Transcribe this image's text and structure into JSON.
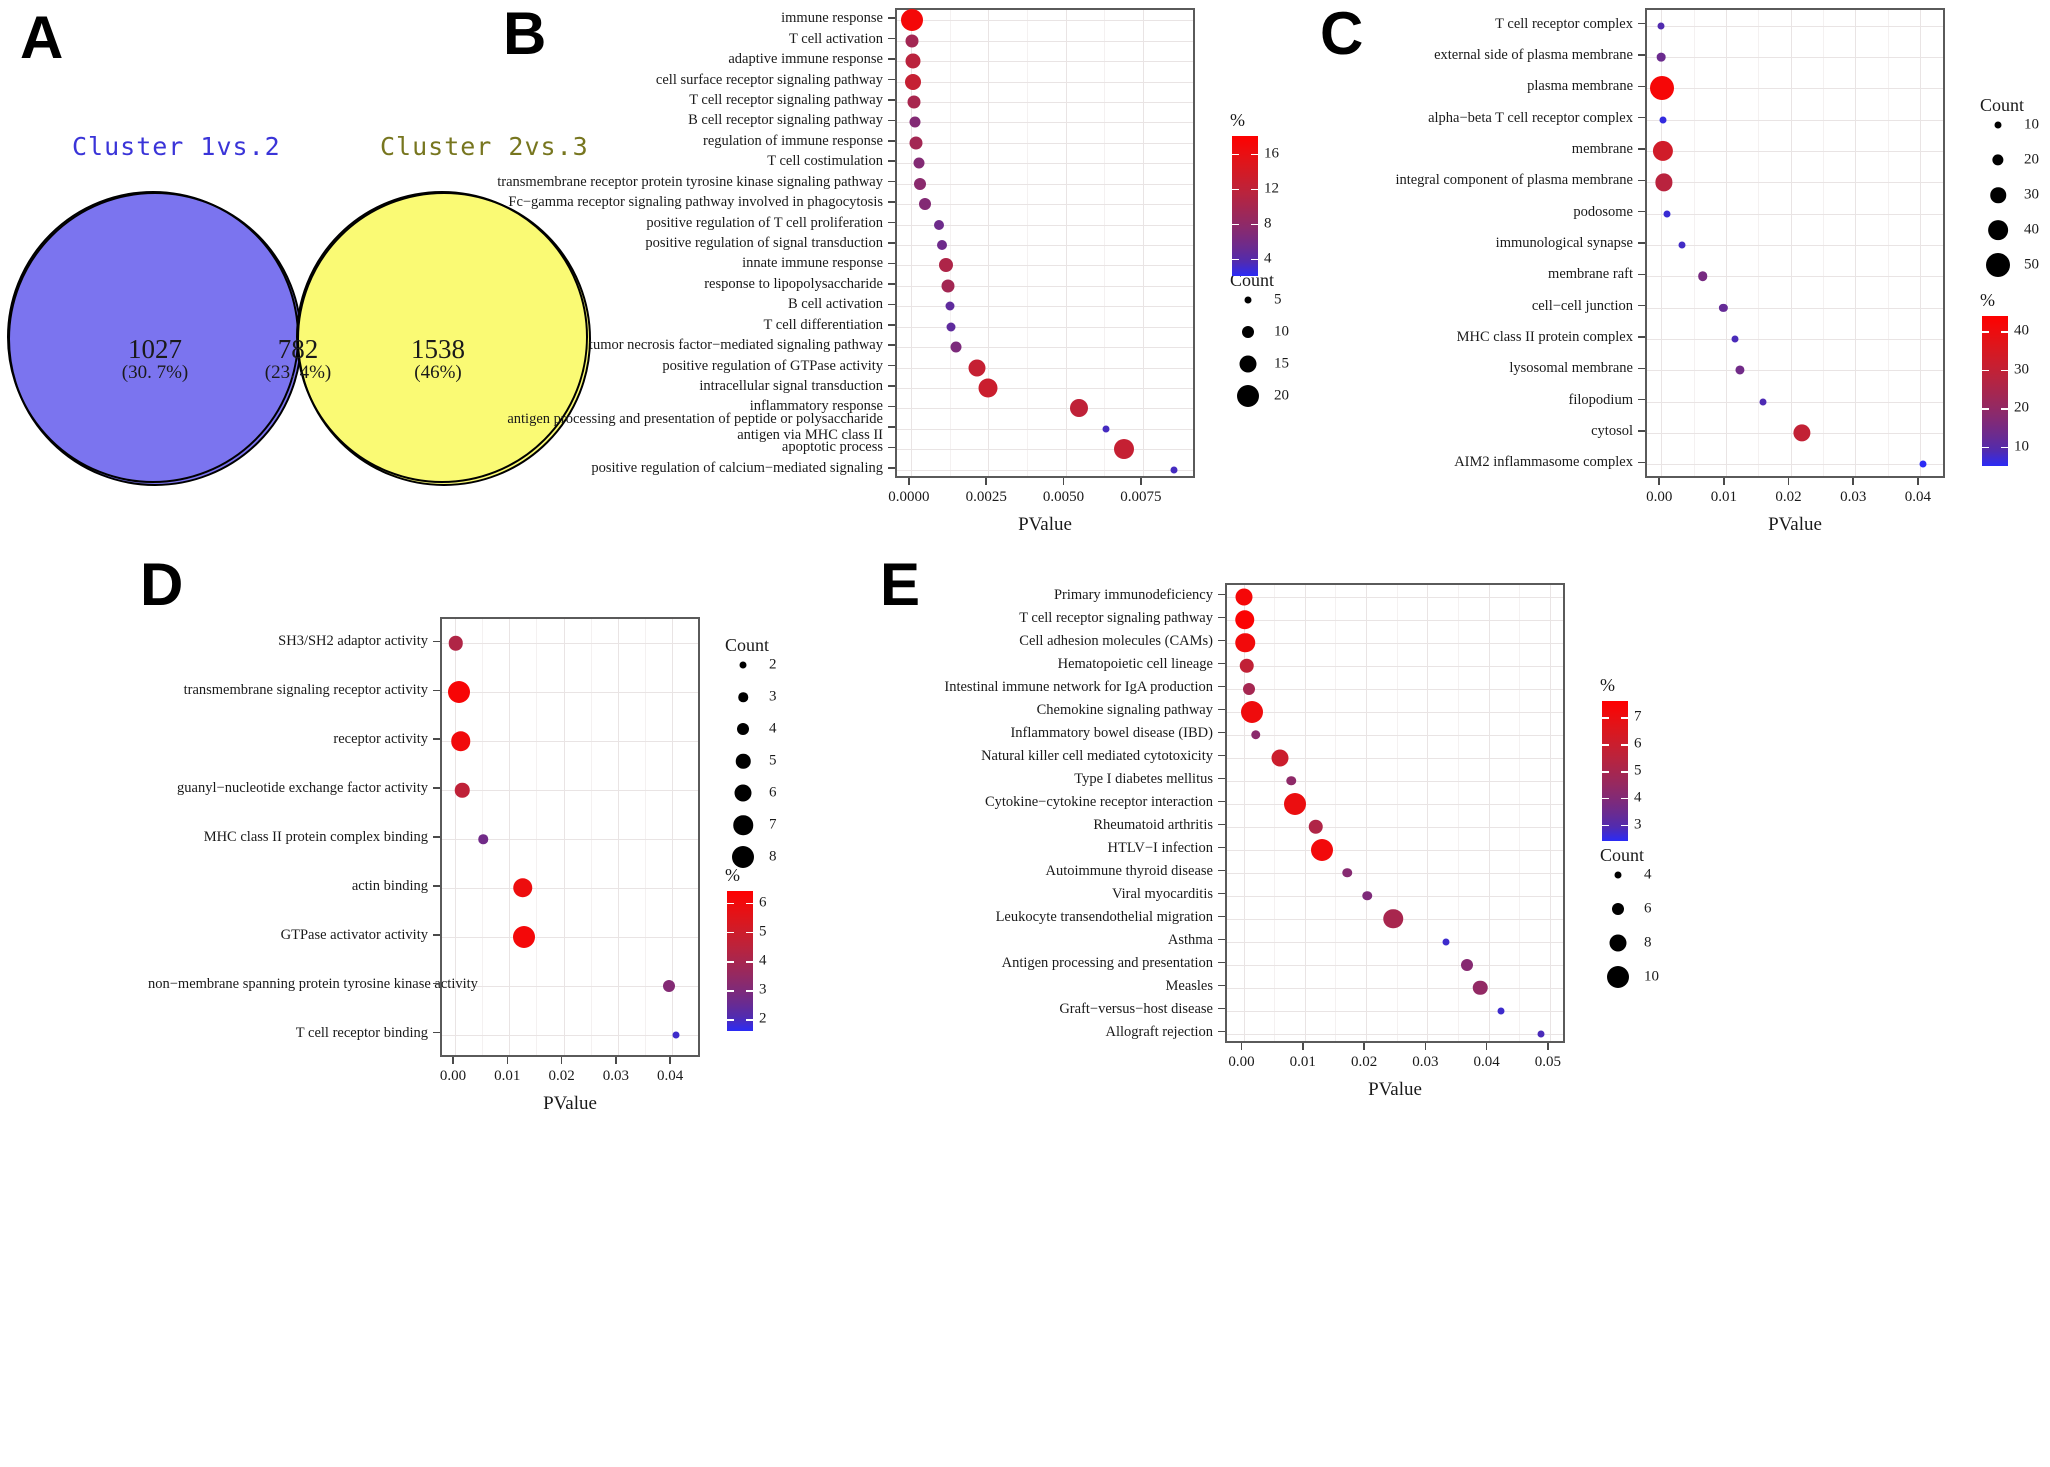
{
  "figure": {
    "panels": [
      "A",
      "B",
      "C",
      "D",
      "E"
    ]
  },
  "panelA": {
    "letter": "A",
    "left_title": "Cluster 1vs.2",
    "right_title": "Cluster 2vs.3",
    "left_color": "#7b74ef",
    "right_color": "#fafa74",
    "overlap_color": "#9d975f",
    "left_title_color": "#3a34d8",
    "right_title_color": "#77761f",
    "regions": [
      {
        "name": "left-only",
        "count": "1027",
        "percent": "(30. 7%)"
      },
      {
        "name": "intersection",
        "count": "782",
        "percent": "(23. 4%)"
      },
      {
        "name": "right-only",
        "count": "1538",
        "percent": "(46%)"
      }
    ]
  },
  "chart_data": [
    {
      "panel": "B",
      "letter": "B",
      "type": "scatter",
      "title": "",
      "xlabel": "PValue",
      "ylabel": "",
      "xlim": [
        -0.00045,
        0.00925
      ],
      "xticks": [
        0.0,
        0.0025,
        0.005,
        0.0075
      ],
      "xticklabels": [
        "0.0000",
        "0.0025",
        "0.0050",
        "0.0075"
      ],
      "grid": true,
      "legend_position": "right",
      "size_legend": {
        "title": "Count",
        "values": [
          5,
          10,
          15,
          20
        ]
      },
      "color_legend": {
        "title": "%",
        "ticks": [
          16,
          12,
          8,
          4
        ],
        "vmin": 2,
        "vmax": 18,
        "low_color": "#2b2bf5",
        "high_color": "#fe0000"
      },
      "categories": [
        "immune response",
        "T cell activation",
        "adaptive immune response",
        "cell surface receptor signaling pathway",
        "T cell receptor signaling pathway",
        "B cell receptor signaling pathway",
        "regulation of immune response",
        "T cell costimulation",
        "transmembrane receptor protein tyrosine kinase signaling pathway",
        "Fc−gamma receptor signaling pathway involved in phagocytosis",
        "positive regulation of T cell proliferation",
        "positive regulation of signal transduction",
        "innate immune response",
        "response to lipopolysaccharide",
        "B cell activation",
        "T cell differentiation",
        "tumor necrosis factor−mediated signaling pathway",
        "positive regulation of GTPase activity",
        "intracellular signal transduction",
        "inflammatory response",
        "antigen processing and presentation of peptide or polysaccharide antigen via MHC class II",
        "apoptotic process",
        "positive regulation of calcium−mediated signaling"
      ],
      "points": [
        {
          "pvalue": 2e-05,
          "count": 21,
          "percent": 17.0
        },
        {
          "pvalue": 4e-05,
          "count": 11,
          "percent": 9.5
        },
        {
          "pvalue": 6e-05,
          "count": 13,
          "percent": 11.5
        },
        {
          "pvalue": 8e-05,
          "count": 14,
          "percent": 12.5
        },
        {
          "pvalue": 0.0001,
          "count": 11,
          "percent": 10.0
        },
        {
          "pvalue": 0.00012,
          "count": 9,
          "percent": 7.0
        },
        {
          "pvalue": 0.00016,
          "count": 11,
          "percent": 9.5
        },
        {
          "pvalue": 0.00025,
          "count": 9,
          "percent": 7.0
        },
        {
          "pvalue": 0.0003,
          "count": 10,
          "percent": 7.5
        },
        {
          "pvalue": 0.00045,
          "count": 10,
          "percent": 7.0
        },
        {
          "pvalue": 0.0009,
          "count": 8,
          "percent": 5.5
        },
        {
          "pvalue": 0.001,
          "count": 8,
          "percent": 5.5
        },
        {
          "pvalue": 0.00115,
          "count": 12,
          "percent": 10.5
        },
        {
          "pvalue": 0.0012,
          "count": 11,
          "percent": 9.5
        },
        {
          "pvalue": 0.00125,
          "count": 7,
          "percent": 4.5
        },
        {
          "pvalue": 0.0013,
          "count": 7,
          "percent": 4.5
        },
        {
          "pvalue": 0.00145,
          "count": 9,
          "percent": 6.5
        },
        {
          "pvalue": 0.00215,
          "count": 15,
          "percent": 12.5
        },
        {
          "pvalue": 0.0025,
          "count": 17,
          "percent": 13.0
        },
        {
          "pvalue": 0.00545,
          "count": 16,
          "percent": 12.0
        },
        {
          "pvalue": 0.0063,
          "count": 4,
          "percent": 3.0
        },
        {
          "pvalue": 0.0069,
          "count": 18,
          "percent": 12.5
        },
        {
          "pvalue": 0.0085,
          "count": 4,
          "percent": 3.0
        }
      ]
    },
    {
      "panel": "C",
      "letter": "C",
      "type": "scatter",
      "xlabel": "PValue",
      "xlim": [
        -0.0022,
        0.0442
      ],
      "xticks": [
        0.0,
        0.01,
        0.02,
        0.03,
        0.04
      ],
      "xticklabels": [
        "0.00",
        "0.01",
        "0.02",
        "0.03",
        "0.04"
      ],
      "grid": true,
      "legend_position": "right",
      "size_legend": {
        "title": "Count",
        "values": [
          10,
          20,
          30,
          40,
          50
        ]
      },
      "color_legend": {
        "title": "%",
        "ticks": [
          40,
          30,
          20,
          10
        ],
        "vmin": 5,
        "vmax": 44,
        "low_color": "#2b2bf5",
        "high_color": "#fe0000"
      },
      "categories": [
        "T cell receptor complex",
        "external side of plasma membrane",
        "plasma membrane",
        "alpha−beta T cell receptor complex",
        "membrane",
        "integral component of plasma membrane",
        "podosome",
        "immunological synapse",
        "membrane raft",
        "cell−cell junction",
        "MHC class II protein complex",
        "lysosomal membrane",
        "filopodium",
        "cytosol",
        "AIM2 inflammasome complex"
      ],
      "points": [
        {
          "pvalue": 2e-05,
          "count": 9,
          "percent": 9.0
        },
        {
          "pvalue": 4e-05,
          "count": 14,
          "percent": 13.0
        },
        {
          "pvalue": 6e-05,
          "count": 52,
          "percent": 42.0
        },
        {
          "pvalue": 0.0002,
          "count": 6,
          "percent": 5.5
        },
        {
          "pvalue": 0.0003,
          "count": 41,
          "percent": 33.0
        },
        {
          "pvalue": 0.0004,
          "count": 34,
          "percent": 28.0
        },
        {
          "pvalue": 0.0009,
          "count": 7,
          "percent": 6.0
        },
        {
          "pvalue": 0.0032,
          "count": 8,
          "percent": 7.0
        },
        {
          "pvalue": 0.0064,
          "count": 16,
          "percent": 15.0
        },
        {
          "pvalue": 0.0096,
          "count": 13,
          "percent": 12.0
        },
        {
          "pvalue": 0.0114,
          "count": 9,
          "percent": 8.0
        },
        {
          "pvalue": 0.0122,
          "count": 15,
          "percent": 14.0
        },
        {
          "pvalue": 0.0158,
          "count": 9,
          "percent": 8.5
        },
        {
          "pvalue": 0.0218,
          "count": 34,
          "percent": 30.0
        },
        {
          "pvalue": 0.0405,
          "count": 5,
          "percent": 4.5
        }
      ]
    },
    {
      "panel": "D",
      "letter": "D",
      "type": "scatter",
      "xlabel": "PValue",
      "xlim": [
        -0.0024,
        0.0455
      ],
      "xticks": [
        0.0,
        0.01,
        0.02,
        0.03,
        0.04
      ],
      "xticklabels": [
        "0.00",
        "0.01",
        "0.02",
        "0.03",
        "0.04"
      ],
      "grid": true,
      "legend_position": "right",
      "size_legend": {
        "title": "Count",
        "values": [
          2,
          3,
          4,
          5,
          6,
          7,
          8
        ]
      },
      "color_legend": {
        "title": "%",
        "ticks": [
          6,
          5,
          4,
          3,
          2
        ],
        "vmin": 1.6,
        "vmax": 6.4,
        "low_color": "#2b2bf5",
        "high_color": "#fe0000"
      },
      "categories": [
        "SH3/SH2 adaptor activity",
        "transmembrane signaling receptor activity",
        "receptor activity",
        "guanyl−nucleotide exchange factor activity",
        "MHC class II protein complex binding",
        "actin binding",
        "GTPase activator activity",
        "non−membrane spanning protein tyrosine kinase activity",
        "T cell receptor binding"
      ],
      "points": [
        {
          "pvalue": 0.0001,
          "count": 5,
          "percent": 4.2
        },
        {
          "pvalue": 0.0008,
          "count": 8,
          "percent": 6.2
        },
        {
          "pvalue": 0.0011,
          "count": 7,
          "percent": 6.0
        },
        {
          "pvalue": 0.0013,
          "count": 5,
          "percent": 4.6
        },
        {
          "pvalue": 0.0052,
          "count": 3,
          "percent": 2.7
        },
        {
          "pvalue": 0.0125,
          "count": 7,
          "percent": 5.9
        },
        {
          "pvalue": 0.0127,
          "count": 8,
          "percent": 6.1
        },
        {
          "pvalue": 0.0395,
          "count": 4,
          "percent": 3.1
        },
        {
          "pvalue": 0.0408,
          "count": 2,
          "percent": 1.8
        }
      ]
    },
    {
      "panel": "E",
      "letter": "E",
      "type": "scatter",
      "xlabel": "PValue",
      "xlim": [
        -0.0027,
        0.0528
      ],
      "xticks": [
        0.0,
        0.01,
        0.02,
        0.03,
        0.04,
        0.05
      ],
      "xticklabels": [
        "0.00",
        "0.01",
        "0.02",
        "0.03",
        "0.04",
        "0.05"
      ],
      "grid": true,
      "legend_position": "right",
      "size_legend": {
        "title": "Count",
        "values": [
          4,
          6,
          8,
          10
        ]
      },
      "color_legend": {
        "title": "%",
        "ticks": [
          7,
          6,
          5,
          4,
          3
        ],
        "vmin": 2.4,
        "vmax": 7.6,
        "low_color": "#2b2bf5",
        "high_color": "#fe0000"
      },
      "categories": [
        "Primary immunodeficiency",
        "T cell receptor signaling pathway",
        "Cell adhesion molecules (CAMs)",
        "Hematopoietic cell lineage",
        "Intestinal immune network for IgA production",
        "Chemokine signaling pathway",
        "Inflammatory bowel disease (IBD)",
        "Natural killer cell mediated cytotoxicity",
        "Type I diabetes mellitus",
        "Cytokine−cytokine receptor interaction",
        "Rheumatoid arthritis",
        "HTLV−I infection",
        "Autoimmune thyroid disease",
        "Viral myocarditis",
        "Leukocyte transendothelial migration",
        "Asthma",
        "Antigen processing and presentation",
        "Measles",
        "Graft−versus−host disease",
        "Allograft rejection"
      ],
      "points": [
        {
          "pvalue": 0.0001,
          "count": 8,
          "percent": 7.3
        },
        {
          "pvalue": 0.0002,
          "count": 9,
          "percent": 7.5
        },
        {
          "pvalue": 0.0003,
          "count": 9,
          "percent": 7.2
        },
        {
          "pvalue": 0.0005,
          "count": 7,
          "percent": 5.7
        },
        {
          "pvalue": 0.0009,
          "count": 6,
          "percent": 4.9
        },
        {
          "pvalue": 0.0014,
          "count": 10,
          "percent": 7.1
        },
        {
          "pvalue": 0.002,
          "count": 5,
          "percent": 4.2
        },
        {
          "pvalue": 0.006,
          "count": 8,
          "percent": 6.0
        },
        {
          "pvalue": 0.0078,
          "count": 5,
          "percent": 4.3
        },
        {
          "pvalue": 0.0084,
          "count": 10,
          "percent": 7.0
        },
        {
          "pvalue": 0.0118,
          "count": 7,
          "percent": 5.2
        },
        {
          "pvalue": 0.0128,
          "count": 11,
          "percent": 7.2
        },
        {
          "pvalue": 0.0169,
          "count": 5,
          "percent": 4.1
        },
        {
          "pvalue": 0.0202,
          "count": 5,
          "percent": 3.9
        },
        {
          "pvalue": 0.0244,
          "count": 9,
          "percent": 5.0
        },
        {
          "pvalue": 0.033,
          "count": 3,
          "percent": 2.6
        },
        {
          "pvalue": 0.0364,
          "count": 6,
          "percent": 4.1
        },
        {
          "pvalue": 0.0386,
          "count": 7,
          "percent": 4.4
        },
        {
          "pvalue": 0.042,
          "count": 3,
          "percent": 2.6
        },
        {
          "pvalue": 0.0485,
          "count": 4,
          "percent": 2.8
        }
      ]
    }
  ]
}
